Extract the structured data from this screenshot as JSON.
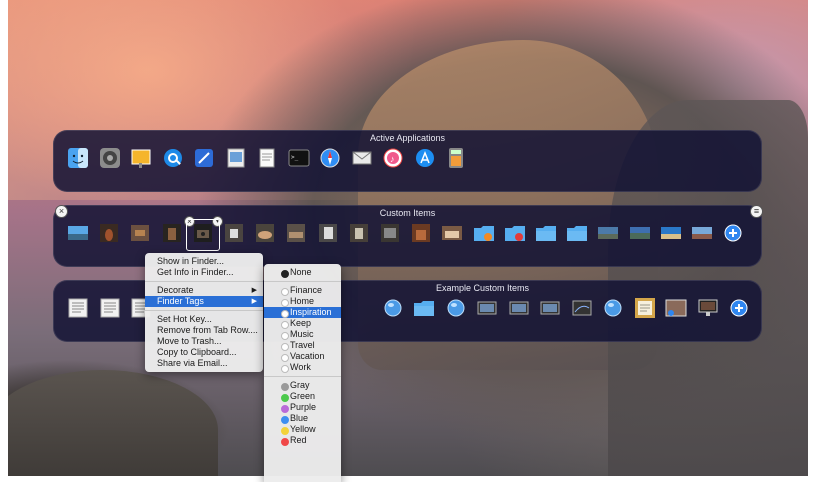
{
  "panels": {
    "active": {
      "title": "Active Applications",
      "icons": [
        "finder-icon",
        "system-preferences-icon",
        "keynote-icon",
        "quicktime-icon",
        "xcode-icon",
        "preview-icon",
        "textedit-icon",
        "terminal-icon",
        "safari-icon",
        "mail-icon",
        "itunes-icon",
        "app-store-icon",
        "calculator-icon"
      ]
    },
    "custom": {
      "title": "Custom Items",
      "icons": [
        "desktop-photo-icon",
        "cello-photo-icon",
        "wood-photo-icon",
        "chair-photo-icon",
        "camera-photo-icon",
        "cup-photo-icon",
        "bowl-photo-icon",
        "table-photo-icon",
        "box-photo-icon",
        "tin-photo-icon",
        "tv-photo-icon",
        "fire-photo-icon",
        "cake-photo-icon",
        "orange-folder-icon",
        "red-folder-icon",
        "blue-folder-icon",
        "folder-icon",
        "city-photo-icon",
        "landscape-photo-icon",
        "beach-photo-icon",
        "harbor-photo-icon",
        "add-icon"
      ]
    },
    "example": {
      "title": "Example Custom Items",
      "icons": [
        "document-icon",
        "document-icon",
        "document-icon",
        "globe-icon",
        "blue-folder-icon",
        "globe-icon",
        "screenshot-icon",
        "screenshot-icon",
        "screenshot-icon",
        "bookmark-icon",
        "globe-icon",
        "notes-icon",
        "photo-icon",
        "monitor-icon",
        "add-icon"
      ]
    }
  },
  "context_menu": {
    "items": [
      {
        "label": "Show in Finder...",
        "type": "item"
      },
      {
        "label": "Get Info in Finder...",
        "type": "item"
      },
      {
        "type": "sep"
      },
      {
        "label": "Decorate",
        "type": "submenu"
      },
      {
        "label": "Finder Tags",
        "type": "submenu",
        "selected": true
      },
      {
        "type": "sep"
      },
      {
        "label": "Set Hot Key...",
        "type": "item"
      },
      {
        "label": "Remove from Tab Row....",
        "type": "item"
      },
      {
        "label": "Move to Trash...",
        "type": "item"
      },
      {
        "label": "Copy to Clipboard...",
        "type": "item"
      },
      {
        "label": "Share via Email...",
        "type": "item"
      }
    ]
  },
  "tag_menu": {
    "items": [
      {
        "label": "None",
        "dot": "#222222",
        "type": "item"
      },
      {
        "type": "sep"
      },
      {
        "label": "Finance",
        "dot": "#ffffff",
        "type": "item"
      },
      {
        "label": "Home",
        "dot": "#ffffff",
        "type": "item"
      },
      {
        "label": "Inspiration",
        "dot": "#ffffff",
        "type": "item",
        "selected": true
      },
      {
        "label": "Keep",
        "dot": "#ffffff",
        "type": "item"
      },
      {
        "label": "Music",
        "dot": "#ffffff",
        "type": "item"
      },
      {
        "label": "Travel",
        "dot": "#ffffff",
        "type": "item"
      },
      {
        "label": "Vacation",
        "dot": "#ffffff",
        "type": "item"
      },
      {
        "label": "Work",
        "dot": "#ffffff",
        "type": "item"
      },
      {
        "type": "sep"
      },
      {
        "label": "Gray",
        "dot": "#9a9a9a",
        "type": "item"
      },
      {
        "label": "Green",
        "dot": "#4cc94c",
        "type": "item"
      },
      {
        "label": "Purple",
        "dot": "#b96ad8",
        "type": "item"
      },
      {
        "label": "Blue",
        "dot": "#3f8ff0",
        "type": "item"
      },
      {
        "label": "Yellow",
        "dot": "#f3d23a",
        "type": "item"
      },
      {
        "label": "Red",
        "dot": "#f04848",
        "type": "item"
      }
    ]
  },
  "colors": {
    "panel_bg": "#121234",
    "menu_highlight": "#2a6fd6"
  }
}
